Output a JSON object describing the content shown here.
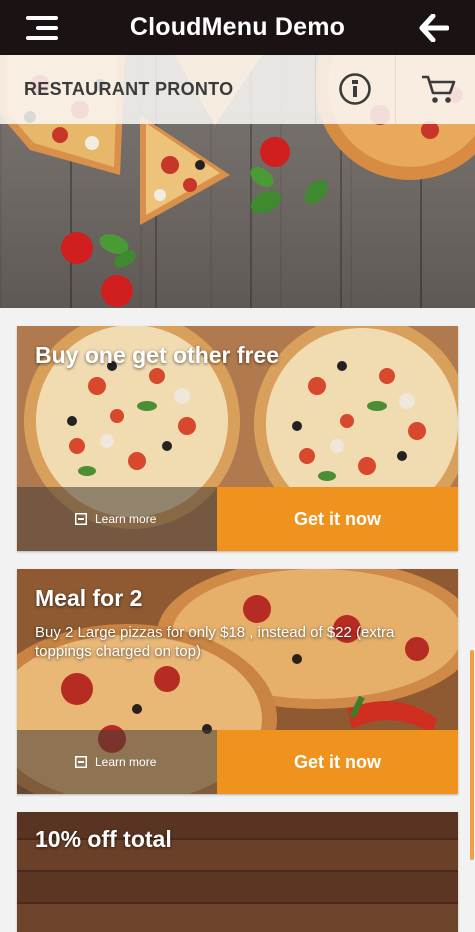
{
  "app": {
    "title": "CloudMenu Demo",
    "menu_icon": "hamburger-menu-icon",
    "back_icon": "arrow-left-icon"
  },
  "restaurant": {
    "name": "RESTAURANT PRONTO",
    "info_icon": "info-icon",
    "cart_icon": "cart-icon"
  },
  "offers": [
    {
      "title": "Buy one get other free",
      "description": "",
      "learn_more": "Learn more",
      "cta": "Get it now"
    },
    {
      "title": "Meal for 2",
      "description": "Buy 2 Large pizzas for only $18 , instead of $22 (extra toppings charged on top)",
      "learn_more": "Learn more",
      "cta": "Get it now"
    },
    {
      "title": "10% off total",
      "description": ""
    }
  ],
  "colors": {
    "topbar": "#1b1313",
    "accent": "#f0921e",
    "background": "#f2f2f2"
  }
}
